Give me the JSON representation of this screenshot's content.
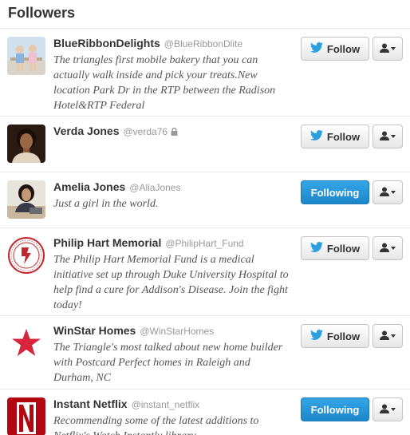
{
  "panel": {
    "title": "Followers"
  },
  "colors": {
    "accent": "#2b9fe0",
    "follow_bird": "#2b9fe0"
  },
  "followers": [
    {
      "name": "BlueRibbonDelights",
      "handle": "@BlueRibbonDlite",
      "protected": false,
      "bio": "The triangles first mobile bakery that you can actually walk inside and pick your treats.New location Park Dr in the RTP between the Radison Hotel&RTP Federal",
      "button": "Follow",
      "following": false,
      "avatar_icon": "kids-photo"
    },
    {
      "name": "Verda Jones",
      "handle": "@verda76",
      "protected": true,
      "bio": "",
      "button": "Follow",
      "following": false,
      "avatar_icon": "woman-portrait"
    },
    {
      "name": "Amelia Jones",
      "handle": "@AliaJones",
      "protected": false,
      "bio": "Just a girl in the world.",
      "button": "Following",
      "following": true,
      "avatar_icon": "woman-desk-photo"
    },
    {
      "name": "Philip Hart Memorial",
      "handle": "@PhilipHart_Fund",
      "protected": false,
      "bio": "The Philip Hart Memorial Fund is a medical initiative set up through Duke University Hospital to help find a cure for Addison's Disease. Join the fight today!",
      "button": "Follow",
      "following": false,
      "avatar_icon": "memorial-seal"
    },
    {
      "name": "WinStar Homes",
      "handle": "@WinStarHomes",
      "protected": false,
      "bio": "The Triangle's most talked about new home builder with Postcard Perfect homes in Raleigh and Durham, NC",
      "button": "Follow",
      "following": false,
      "avatar_icon": "red-star-logo"
    },
    {
      "name": "Instant Netflix",
      "handle": "@instant_netflix",
      "protected": false,
      "bio": "Recommending some of the latest additions to Netflix's Watch Instantly library",
      "button": "Following",
      "following": true,
      "avatar_icon": "netflix-logo"
    }
  ]
}
